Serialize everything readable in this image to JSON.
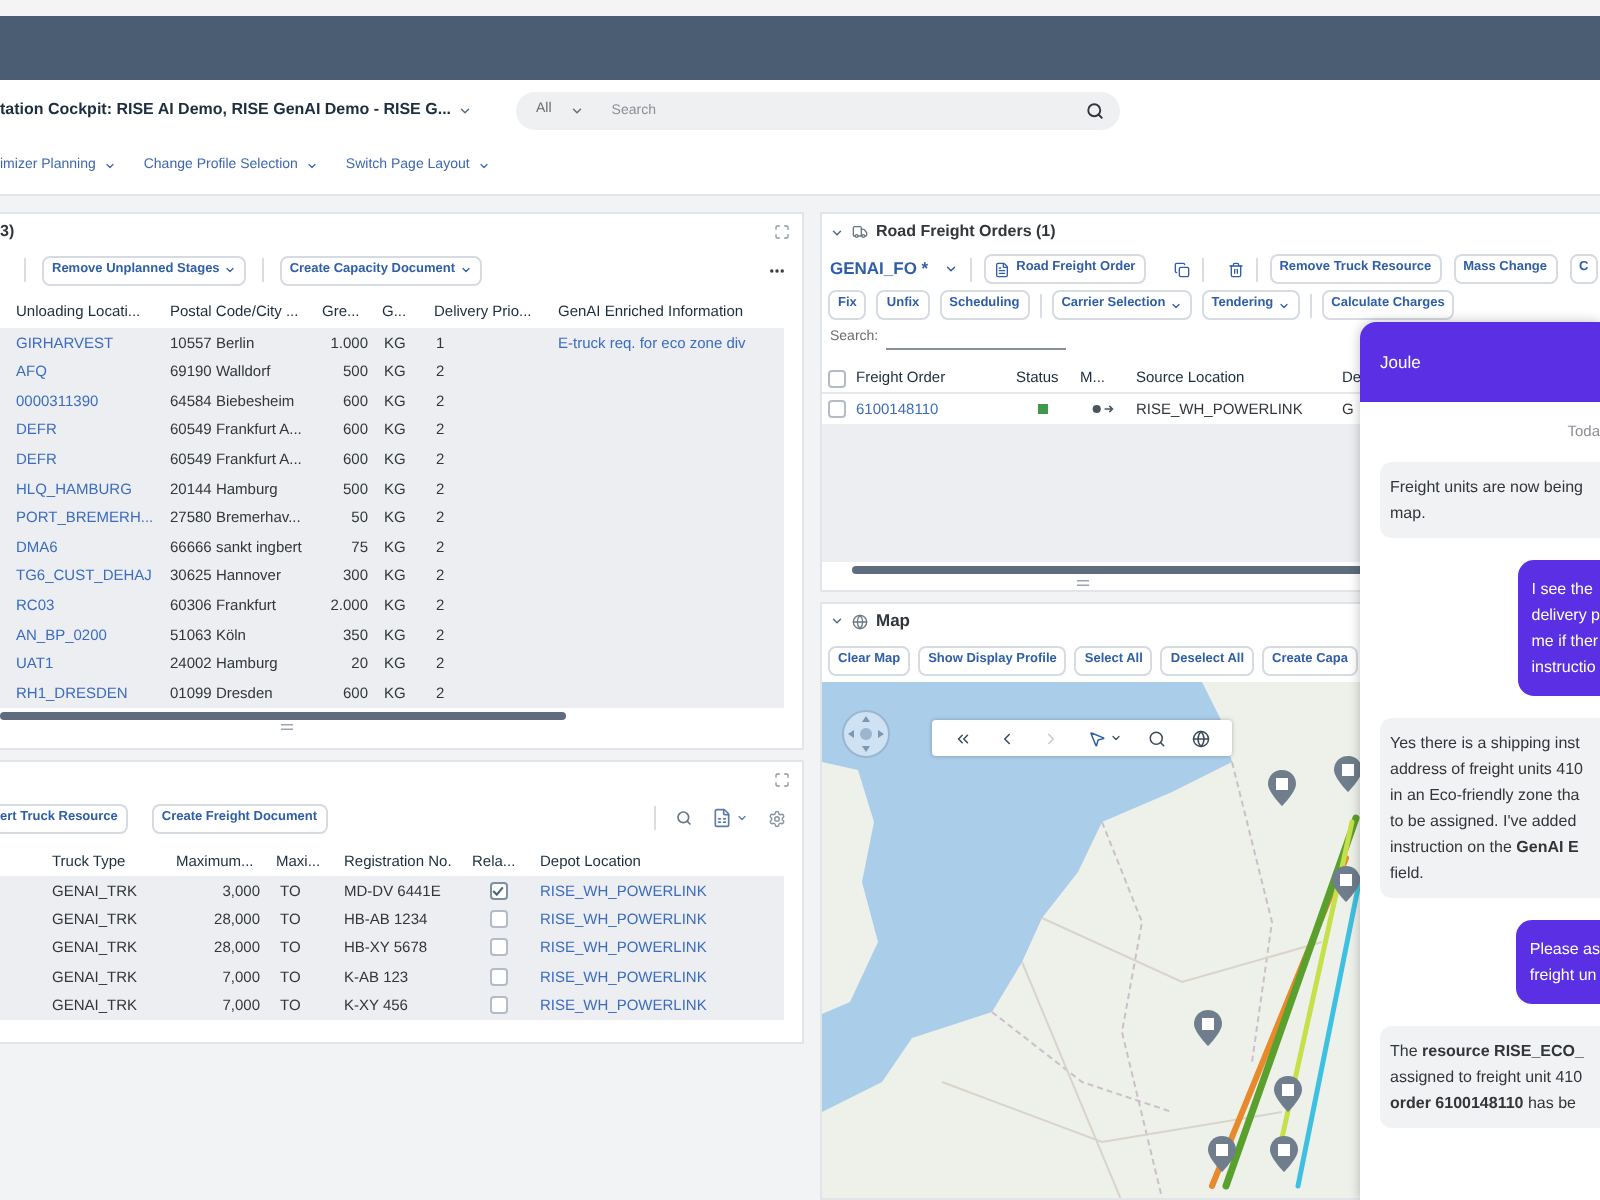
{
  "header": {
    "title": "tation Cockpit: RISE AI Demo, RISE GenAI Demo - RISE G...",
    "search": {
      "scope": "All",
      "placeholder": "Search"
    }
  },
  "menu": [
    "imizer Planning",
    "Change Profile Selection",
    "Switch Page Layout"
  ],
  "stages": {
    "title": "3)",
    "toolbar": [
      {
        "label": "Remove Unplanned Stages",
        "kind": "menu"
      },
      {
        "label": "Create Capacity Document",
        "kind": "menu"
      }
    ],
    "columns": [
      "Unloading Locati...",
      "Postal Code/City ...",
      "Gre...",
      "G...",
      "Delivery Prio...",
      "GenAI Enriched Information"
    ],
    "rows": [
      [
        "GIRHARVEST",
        "10557 Berlin",
        "1.000",
        "KG",
        "1",
        "E-truck req. for eco zone div"
      ],
      [
        "AFQ",
        "69190 Walldorf",
        "500",
        "KG",
        "2"
      ],
      [
        "0000311390",
        "64584 Biebesheim",
        "600",
        "KG",
        "2"
      ],
      [
        "DEFR",
        "60549 Frankfurt A...",
        "600",
        "KG",
        "2"
      ],
      [
        "DEFR",
        "60549 Frankfurt A...",
        "600",
        "KG",
        "2"
      ],
      [
        "HLQ_HAMBURG",
        "20144 Hamburg",
        "500",
        "KG",
        "2"
      ],
      [
        "PORT_BREMERH...",
        "27580 Bremerhav...",
        "50",
        "KG",
        "2"
      ],
      [
        "DMA6",
        "66666 sankt ingbert",
        "75",
        "KG",
        "2"
      ],
      [
        "TG6_CUST_DEHAJ",
        "30625 Hannover",
        "300",
        "KG",
        "2"
      ],
      [
        "RC03",
        "60306 Frankfurt",
        "2.000",
        "KG",
        "2"
      ],
      [
        "AN_BP_0200",
        "51063 Köln",
        "350",
        "KG",
        "2"
      ],
      [
        "UAT1",
        "24002 Hamburg",
        "20",
        "KG",
        "2"
      ],
      [
        "RH1_DRESDEN",
        "01099 Dresden",
        "600",
        "KG",
        "2"
      ]
    ]
  },
  "resources": {
    "toolbar": [
      {
        "label": "ert Truck Resource",
        "kind": "button"
      },
      {
        "label": "Create Freight Document",
        "kind": "button"
      }
    ],
    "columns": [
      "Truck Type",
      "Maximum...",
      "Maxi...",
      "Registration No.",
      "Rela...",
      "Depot Location"
    ],
    "rows": [
      {
        "truck_type": "GENAI_TRK",
        "maximum": "3,000",
        "unit": "TO",
        "registration": "MD-DV 6441E",
        "checked": true,
        "depot": "RISE_WH_POWERLINK"
      },
      {
        "truck_type": "GENAI_TRK",
        "maximum": "28,000",
        "unit": "TO",
        "registration": "HB-AB 1234",
        "checked": false,
        "depot": "RISE_WH_POWERLINK"
      },
      {
        "truck_type": "GENAI_TRK",
        "maximum": "28,000",
        "unit": "TO",
        "registration": "HB-XY 5678",
        "checked": false,
        "depot": "RISE_WH_POWERLINK"
      },
      {
        "truck_type": "GENAI_TRK",
        "maximum": "7,000",
        "unit": "TO",
        "registration": "K-AB 123",
        "checked": false,
        "depot": "RISE_WH_POWERLINK"
      },
      {
        "truck_type": "GENAI_TRK",
        "maximum": "7,000",
        "unit": "TO",
        "registration": "K-XY 456",
        "checked": false,
        "depot": "RISE_WH_POWERLINK"
      }
    ]
  },
  "freight_orders": {
    "title": "Road Freight Orders (1)",
    "expanded": true,
    "variant": "GENAI_FO *",
    "create_button": "Road Freight Order",
    "actions": [
      "Remove Truck Resource",
      "Mass Change",
      "C"
    ],
    "toolbar_groups": [
      {
        "buttons": [
          {
            "label": "Fix",
            "kind": "button"
          },
          {
            "label": "Unfix",
            "kind": "button"
          },
          {
            "label": "Scheduling",
            "kind": "button"
          }
        ]
      },
      {
        "buttons": [
          {
            "label": "Carrier Selection",
            "kind": "menu"
          },
          {
            "label": "Tendering",
            "kind": "menu"
          }
        ]
      },
      {
        "buttons": [
          {
            "label": "Calculate Charges",
            "kind": "button"
          }
        ]
      }
    ],
    "search_label": "Search:",
    "columns": [
      "Freight Order",
      "Status",
      "M...",
      "Source Location",
      "De"
    ],
    "all_checked": false,
    "rows": [
      {
        "checked": false,
        "freight_order": "6100148110",
        "status": {
          "color": "#3d9a4b"
        },
        "source": "RISE_WH_POWERLINK",
        "column_5": "G"
      }
    ]
  },
  "map": {
    "title": "Map",
    "expanded": true,
    "buttons": [
      "Clear Map",
      "Show Display Profile",
      "Select All",
      "Deselect All",
      "Create Capa"
    ]
  },
  "assistant": {
    "title": "Joule",
    "date": "Toda",
    "messages": [
      {
        "kind": "bot",
        "lines": [
          "Freight units are now being",
          "map."
        ]
      },
      {
        "kind": "user",
        "lines": [
          "I see the",
          "delivery p",
          "me if ther",
          "instructio"
        ]
      },
      {
        "kind": "bot",
        "lines": [
          "Yes there is a shipping inst",
          "address of freight units 410",
          "in an Eco-friendly zone tha",
          "to be assigned. I've added",
          "instruction on the **GenAI E**",
          "field."
        ]
      },
      {
        "kind": "user",
        "lines": [
          "Please as",
          "freight un"
        ]
      },
      {
        "kind": "bot",
        "lines": [
          "The **resource RISE_ECO_**",
          "assigned to freight unit 410",
          "**order 6100148110** has be"
        ]
      }
    ]
  }
}
